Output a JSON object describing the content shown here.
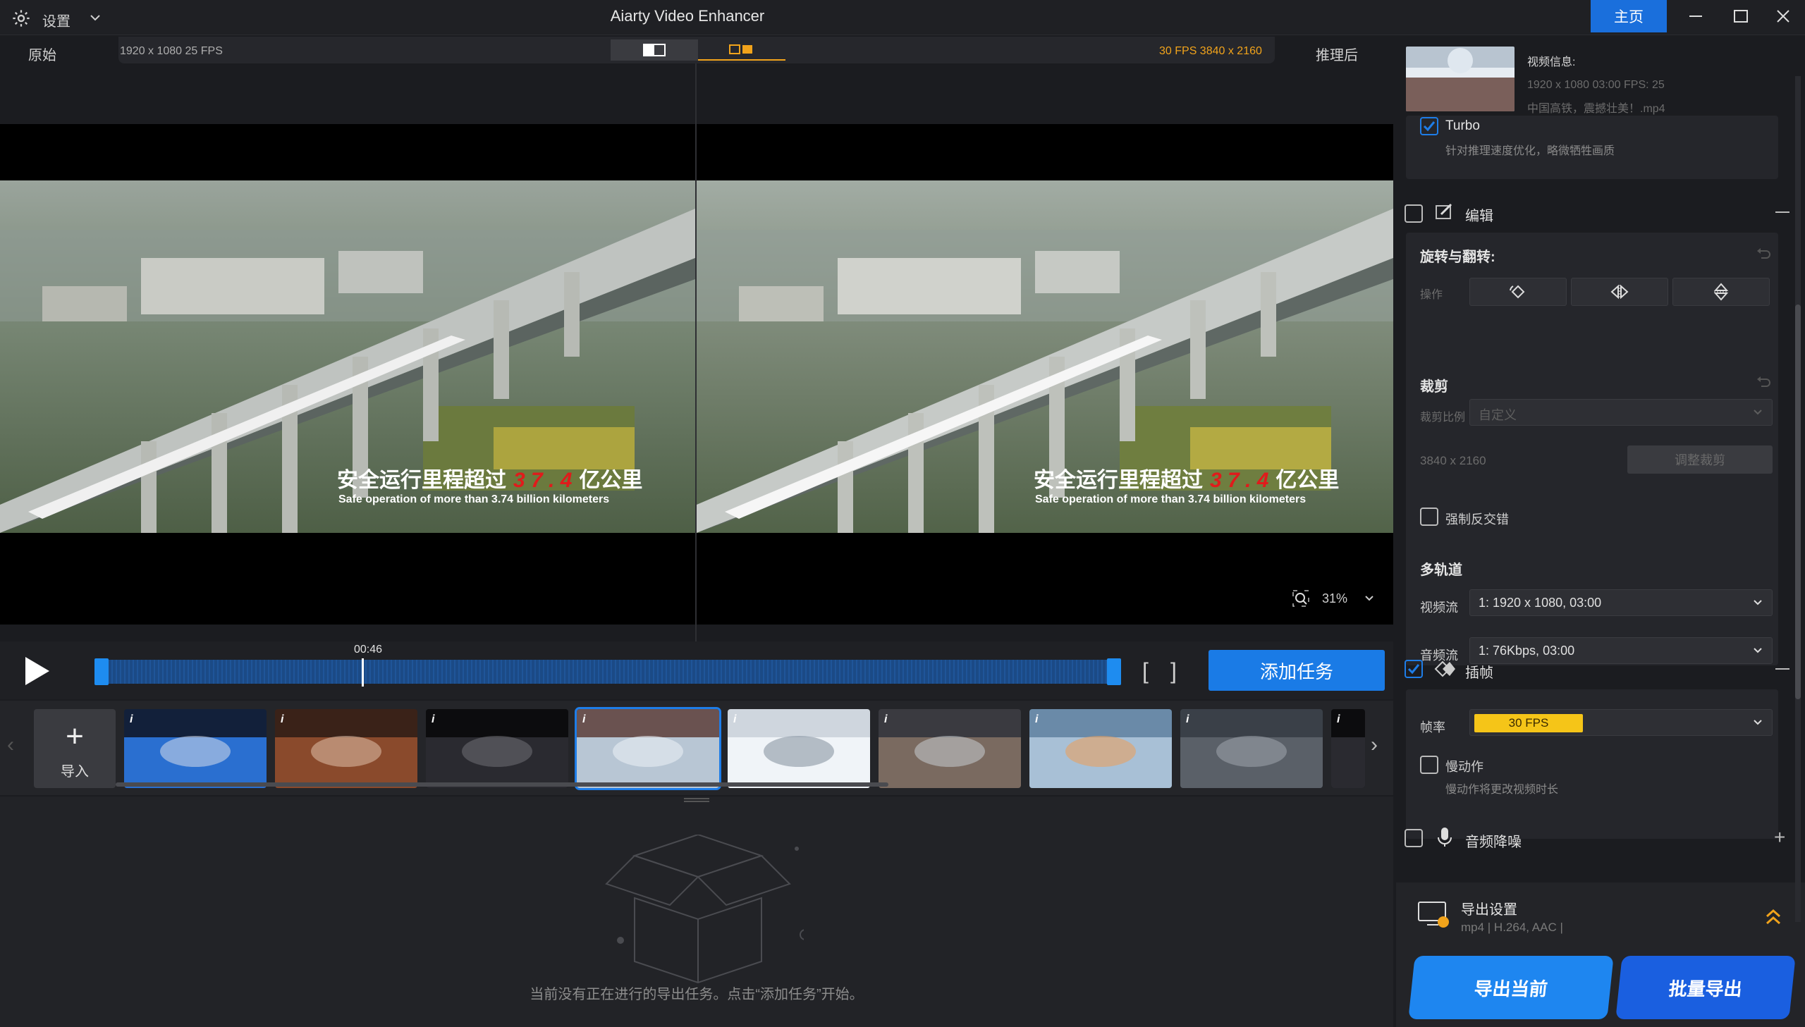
{
  "titlebar": {
    "settings_label": "设置",
    "app_title": "Aiarty Video Enhancer",
    "home_label": "主页"
  },
  "preview": {
    "label_original": "原始",
    "info_original": "1920 x 1080  25 FPS",
    "info_enhanced": "30 FPS  3840 x 2160",
    "label_after": "推理后",
    "caption_cn_prefix": "安全运行里程超过",
    "caption_cn_num": "3 7 . 4",
    "caption_cn_suffix": "亿公里",
    "caption_en": "Safe operation of more than 3.74 billion kilometers",
    "zoom": "31%"
  },
  "timeline": {
    "current_time": "00:46",
    "playhead_fraction": 0.26,
    "add_task_label": "添加任务"
  },
  "thumbs": {
    "import_label": "导入",
    "items": [
      {
        "info": "i",
        "selected": false,
        "tone": "blue"
      },
      {
        "info": "i",
        "selected": false,
        "tone": "warm"
      },
      {
        "info": "i",
        "selected": false,
        "tone": "dark"
      },
      {
        "info": "i",
        "selected": true,
        "tone": "station"
      },
      {
        "info": "i",
        "selected": false,
        "tone": "white"
      },
      {
        "info": "i",
        "selected": false,
        "tone": "city"
      },
      {
        "info": "i",
        "selected": false,
        "tone": "sky"
      },
      {
        "info": "i",
        "selected": false,
        "tone": "grey"
      },
      {
        "info": "i",
        "selected": false,
        "tone": "dark"
      }
    ]
  },
  "tasks": {
    "empty_text": "当前没有正在进行的导出任务。点击“添加任务”开始。"
  },
  "side": {
    "video_info_label": "视频信息:",
    "video_info_res": "1920 x 1080  03:00    FPS: 25",
    "video_info_file": "中国高铁，震撼壮美！.mp4",
    "turbo_label": "Turbo",
    "turbo_desc": "针对推理速度优化，略微牺牲画质",
    "edit_label": "编辑",
    "rotate_title": "旋转与翻转:",
    "operation_label": "操作",
    "crop_title": "裁剪",
    "crop_ratio_label": "裁剪比例",
    "crop_ratio_value": "自定义",
    "crop_size": "3840 x 2160",
    "adjust_crop_label": "调整裁剪",
    "deinterlace_label": "强制反交错",
    "multitrack_title": "多轨道",
    "video_stream_label": "视频流",
    "video_stream_value": "1: 1920 x 1080,  03:00",
    "audio_stream_label": "音频流",
    "audio_stream_value": "1: 76Kbps,  03:00",
    "interp_label": "插帧",
    "framerate_label": "帧率",
    "framerate_value": "30 FPS",
    "slowmo_label": "慢动作",
    "slowmo_desc": "慢动作将更改视频时长",
    "denoise_label": "音频降噪",
    "export_settings_label": "导出设置",
    "export_settings_value": "mp4 | H.264, AAC |",
    "export_current_label": "导出当前",
    "export_batch_label": "批量导出",
    "colors": {
      "accent": "#1e7de8",
      "fps_badge": "#f5c518",
      "orange": "#f1a31b"
    }
  }
}
